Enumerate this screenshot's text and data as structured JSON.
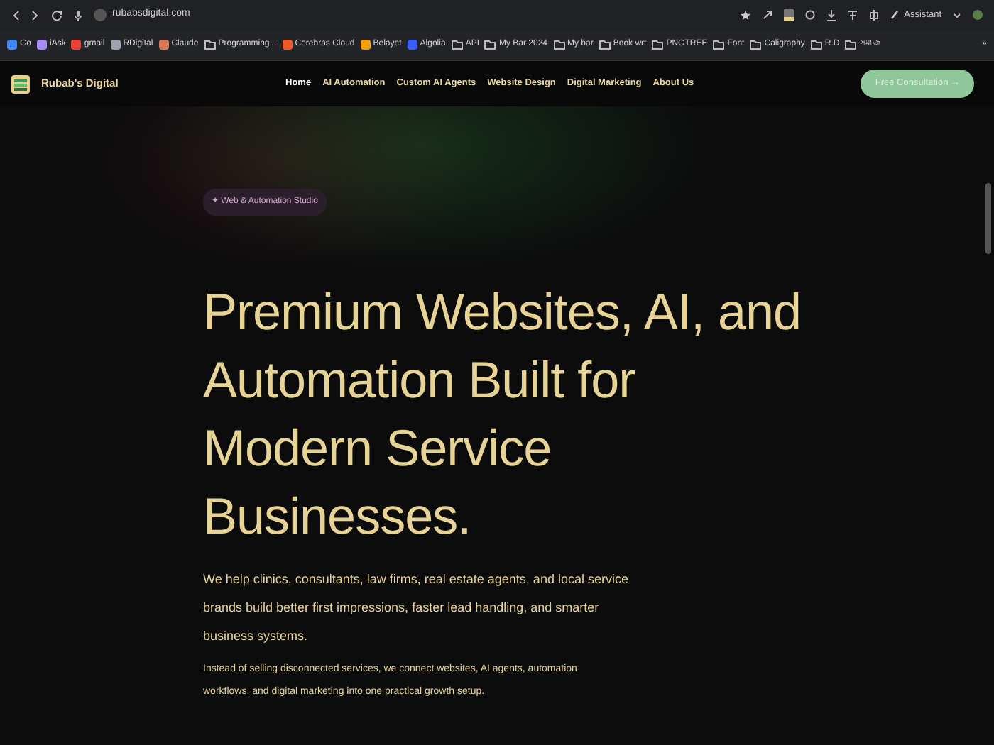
{
  "browser": {
    "url": "rubabsdigital.com",
    "assistant_label": "Assistant",
    "bookmarks": [
      {
        "label": "Go",
        "kind": "site",
        "color": "#4285f4"
      },
      {
        "label": "iAsk",
        "kind": "site",
        "color": "#a78bfa"
      },
      {
        "label": "gmail",
        "kind": "site",
        "color": "#ea4335"
      },
      {
        "label": "RDigital",
        "kind": "site",
        "color": "#9ca3af"
      },
      {
        "label": "Claude",
        "kind": "site",
        "color": "#d97757"
      },
      {
        "label": "Programming...",
        "kind": "folder"
      },
      {
        "label": "Cerebras Cloud",
        "kind": "site",
        "color": "#f05a28"
      },
      {
        "label": "Belayet",
        "kind": "site",
        "color": "#f59e0b"
      },
      {
        "label": "Algolia",
        "kind": "site",
        "color": "#3b5bfd"
      },
      {
        "label": "API",
        "kind": "folder"
      },
      {
        "label": "My Bar 2024",
        "kind": "folder"
      },
      {
        "label": "My bar",
        "kind": "folder"
      },
      {
        "label": "Book wrt",
        "kind": "folder"
      },
      {
        "label": "PNGTREE",
        "kind": "folder"
      },
      {
        "label": "Font",
        "kind": "folder"
      },
      {
        "label": "Caligraphy",
        "kind": "folder"
      },
      {
        "label": "R.D",
        "kind": "folder"
      },
      {
        "label": "সমাজ",
        "kind": "folder"
      }
    ],
    "more_label": "»"
  },
  "navbar": {
    "brand": "Rubab's Digital",
    "links": [
      {
        "label": "Home",
        "selected": true
      },
      {
        "label": "AI Automation",
        "selected": false
      },
      {
        "label": "Custom AI Agents",
        "selected": false
      },
      {
        "label": "Website Design",
        "selected": false
      },
      {
        "label": "Digital Marketing",
        "selected": false
      },
      {
        "label": "About Us",
        "selected": false
      }
    ],
    "cta": "Free Consultation →"
  },
  "hero": {
    "badge": "✦ Web & Automation Studio",
    "headline": "Premium Websites, AI, and Automation Built for Modern Service Businesses.",
    "lead": "We help clinics, consultants, law firms, real estate agents, and local service brands build better first impressions, faster lead handling, and smarter business systems.",
    "body": "Instead of selling disconnected services, we connect websites, AI agents, automation workflows, and digital marketing into one practical growth setup."
  }
}
